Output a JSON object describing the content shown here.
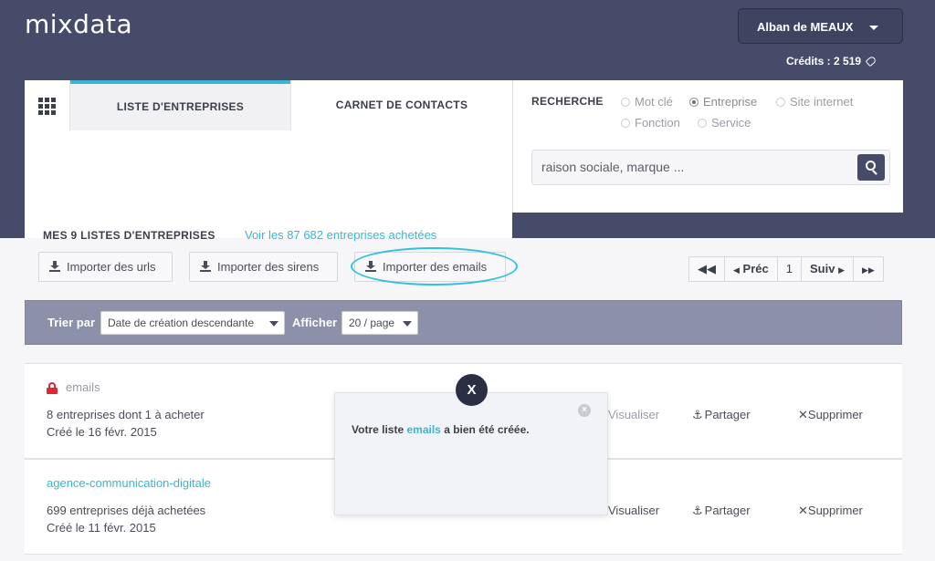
{
  "header": {
    "logo": "mixdata",
    "user_name": "Alban de MEAUX",
    "credits": "Crédits : 2 519"
  },
  "tabs": [
    {
      "label": "LISTE D'ENTREPRISES",
      "active": true
    },
    {
      "label": "CARNET DE CONTACTS",
      "active": false
    }
  ],
  "search": {
    "title": "RECHERCHE",
    "options": [
      {
        "label": "Mot clé",
        "selected": false
      },
      {
        "label": "Entreprise",
        "selected": true
      },
      {
        "label": "Site internet",
        "selected": false
      },
      {
        "label": "Fonction",
        "selected": false
      },
      {
        "label": "Service",
        "selected": false
      }
    ],
    "placeholder": "raison sociale, marque ..."
  },
  "lists": {
    "heading": "MES 9 LISTES D'ENTREPRISES",
    "link": "Voir les 87 682 entreprises achetées",
    "import_buttons": [
      "Importer des urls",
      "Importer des sirens",
      "Importer des emails"
    ],
    "pager": {
      "first": "",
      "prev": "Préc",
      "page": "1",
      "next": "Suiv",
      "last": ""
    }
  },
  "sort_bar": {
    "sort_label": "Trier par",
    "sort_value": "Date de création descendante",
    "show_label": "Afficher",
    "show_value": "20 / page"
  },
  "rows": [
    {
      "name": "emails",
      "locked": true,
      "line1": "8 entreprises dont 1 à acheter",
      "line2": "Créé le 16 févr. 2015",
      "view": "Visualiser",
      "share": "Partager",
      "delete": "Supprimer"
    },
    {
      "name": "agence-communication-digitale",
      "locked": false,
      "line1": "699 entreprises déjà achetées",
      "line2": "Créé le 11 févr. 2015",
      "view": "Visualiser",
      "share": "Partager",
      "delete": "Supprimer"
    }
  ],
  "toast": {
    "prefix": "Votre liste",
    "list_name": "emails",
    "suffix": "a bien été créée.",
    "close_glyph": "×",
    "dismiss_glyph": "X"
  },
  "colors": {
    "header_bg": "#464b69",
    "accent": "#37b6d6",
    "sort_bar": "#8c90a8",
    "lock": "#e0262f"
  }
}
